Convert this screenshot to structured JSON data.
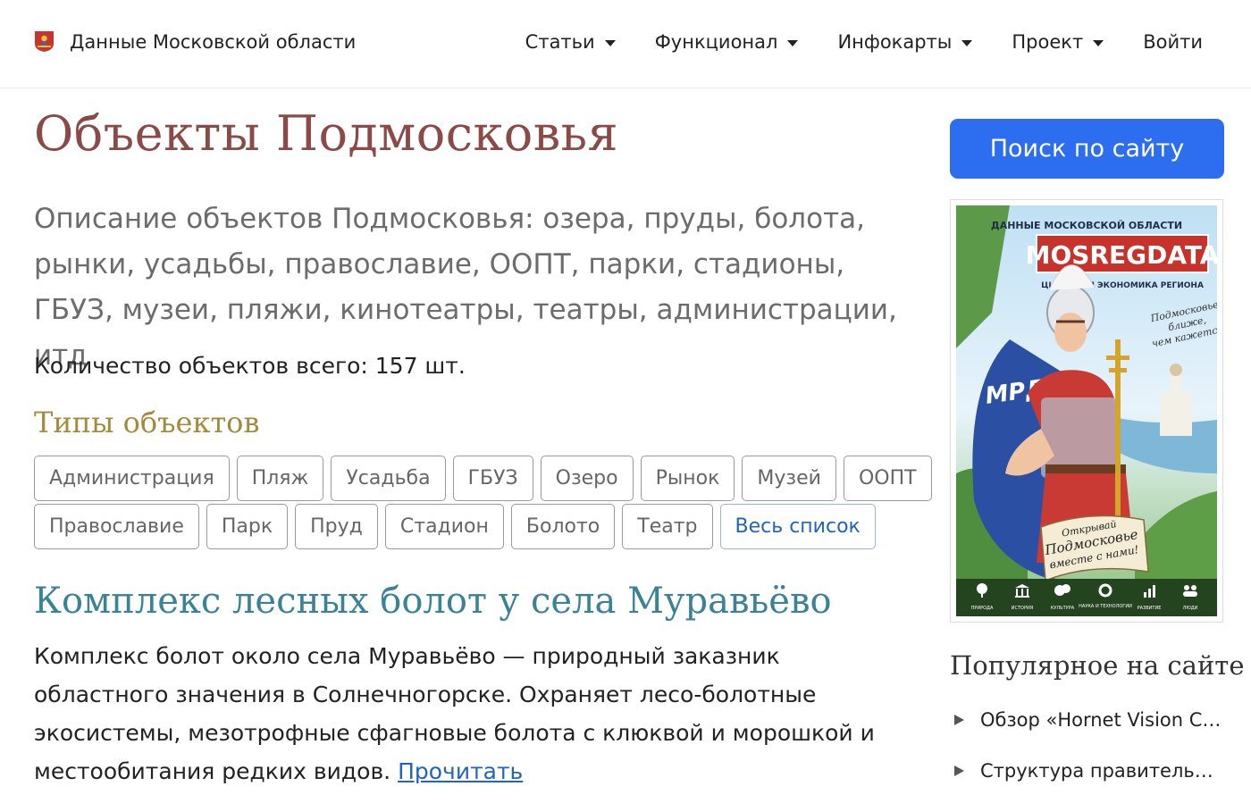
{
  "header": {
    "brand": "Данные Московской области",
    "nav": [
      {
        "label": "Статьи",
        "dropdown": true
      },
      {
        "label": "Функционал",
        "dropdown": true
      },
      {
        "label": "Инфокарты",
        "dropdown": true
      },
      {
        "label": "Проект",
        "dropdown": true
      },
      {
        "label": "Войти",
        "dropdown": false
      }
    ]
  },
  "main": {
    "title": "Объекты Подмосковья",
    "lead": "Описание объектов Подмосковья: озера, пруды, болота, рынки, усадьбы, православие, ООПТ, парки, стадионы, ГБУЗ, музеи, пляжи, кинотеатры, театры, администрации, итд",
    "count": "Количество объектов всего: 157 шт.",
    "types_title": "Типы объектов",
    "tags_row1": [
      "Администрация",
      "Пляж",
      "Усадьба",
      "ГБУЗ",
      "Озеро",
      "Рынок",
      "Музей",
      "ООПТ"
    ],
    "tags_row2": [
      "Православие",
      "Парк",
      "Пруд",
      "Стадион",
      "Болото",
      "Театр"
    ],
    "all_list": "Весь список",
    "article": {
      "title": "Комплекс лесных болот у села Муравьёво",
      "text": "Комплекс болот около села Муравьёво — природный заказник областного значения в Солнечногорске. Охраняет лесо-болотные экосистемы, мезотрофные сфагновые болота с клюквой и морошкой и местообитания редких видов. ",
      "read_more": "Прочитать"
    }
  },
  "sidebar": {
    "search_button": "Поиск по сайту",
    "poster": {
      "top_line": "ДАННЫЕ МОСКОВСКОЙ ОБЛАСТИ",
      "brand": "MOSREGDATA",
      "subtitle": "ЦИФРОВАЯ ЭКОНОМИКА РЕГИОНА",
      "shield_text": "МРД",
      "slogan_right": [
        "Подмосковье",
        "ближе,",
        "чем кажется!"
      ],
      "banner": [
        "Открывай",
        "Подмосковье",
        "вместе с нами!"
      ],
      "icons": [
        {
          "name": "tree-icon",
          "label": "ПРИРОДА"
        },
        {
          "name": "museum-icon",
          "label": "ИСТОРИЯ"
        },
        {
          "name": "masks-icon",
          "label": "КУЛЬТУРА"
        },
        {
          "name": "gear-icon",
          "label": "НАУКА И ТЕХНОЛОГИИ"
        },
        {
          "name": "bar-chart-icon",
          "label": "РАЗВИТИЕ"
        },
        {
          "name": "people-icon",
          "label": "ЛЮДИ"
        }
      ]
    },
    "popular_title": "Популярное на сайте",
    "popular": [
      "Обзор «Hornet Vision Cyber»",
      "Структура правительства Московской области"
    ]
  },
  "colors": {
    "title": "#8a4a48",
    "types_title": "#a38a3c",
    "article_title": "#3a8296",
    "link": "#2364b8",
    "search_button": "#2d6ef0"
  }
}
